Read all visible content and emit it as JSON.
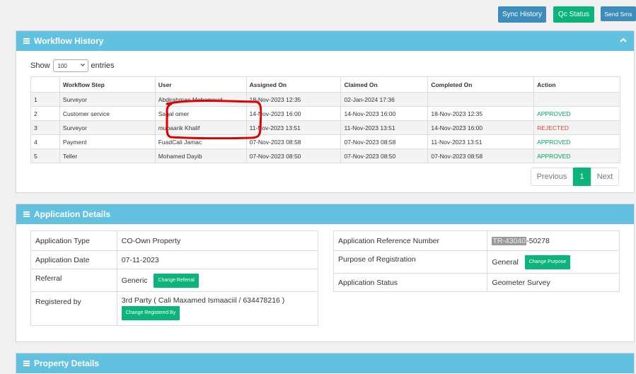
{
  "top_actions": {
    "sync_history": "Sync History",
    "qc_status": "Qc Status",
    "send_sms": "Send Sms"
  },
  "workflow": {
    "title": "Workflow History",
    "show_label": "Show",
    "entries_value": "100",
    "entries_label": "entries",
    "columns": [
      "",
      "Workflow Step",
      "User",
      "Assigned On",
      "Claimed On",
      "Completed On",
      "Action"
    ],
    "rows": [
      [
        "1",
        "Surveyor",
        "Abdirahman Mohamoud",
        "18-Nov-2023 12:35",
        "02-Jan-2024 17:36",
        "",
        ""
      ],
      [
        "2",
        "Customer service",
        "Sagal omer",
        "14-Nov-2023 16:00",
        "14-Nov-2023 16:00",
        "18-Nov-2023 12:35",
        "APPROVED"
      ],
      [
        "3",
        "Surveyor",
        "mubaarik Khalif",
        "11-Nov-2023 13:51",
        "11-Nov-2023 13:51",
        "14-Nov-2023 16:00",
        "REJECTED"
      ],
      [
        "4",
        "Payment",
        "FuadCali Jamac",
        "07-Nov-2023 08:58",
        "07-Nov-2023 08:58",
        "11-Nov-2023 13:51",
        "APPROVED"
      ],
      [
        "5",
        "Teller",
        "Mohamed Dayib",
        "07-Nov-2023 08:50",
        "07-Nov-2023 08:50",
        "07-Nov-2023 08:58",
        "APPROVED"
      ]
    ],
    "pagination": {
      "previous": "Previous",
      "page": "1",
      "next": "Next"
    }
  },
  "application": {
    "title": "Application Details",
    "type_label": "Application Type",
    "type_value": "CO-Own Property",
    "date_label": "Application Date",
    "date_value": "07-11-2023",
    "referral_label": "Referral",
    "referral_value": "Generic",
    "change_referral": "Change Referral",
    "registered_label": "Registered by",
    "registered_value": "3rd Party ( Cali Maxamed Ismaaciil / 634478216 )",
    "change_registered": "Change Registered By",
    "ref_label": "Application Reference Number",
    "ref_value_selected": "TR-43040",
    "ref_value_rest": "-50278",
    "purpose_label": "Purpose of Registration",
    "purpose_value": "General",
    "change_purpose": "Change Purpose",
    "status_label": "Application Status",
    "status_value": "Geometer Survey"
  },
  "property": {
    "title": "Property Details"
  },
  "colors": {
    "panel_header": "#62c1df",
    "primary_blue": "#3c8dbc",
    "green": "#0ab47c",
    "approved": "#00a65a",
    "rejected": "#dd4b39",
    "annotation_red": "#e00000"
  }
}
